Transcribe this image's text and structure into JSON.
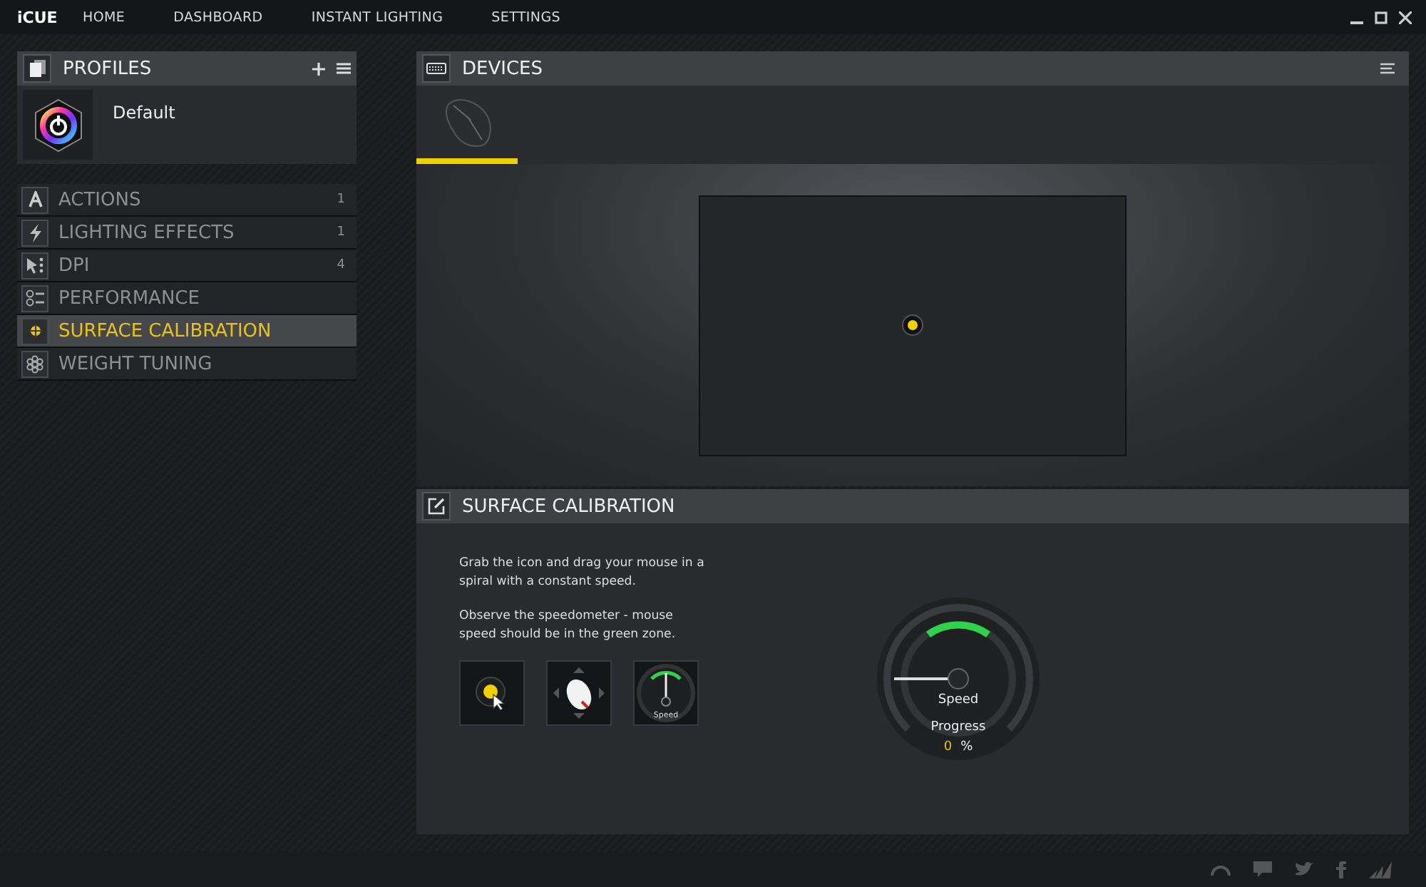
{
  "app": {
    "logo": "iCUE"
  },
  "nav": [
    {
      "label": "HOME"
    },
    {
      "label": "DASHBOARD"
    },
    {
      "label": "INSTANT LIGHTING"
    },
    {
      "label": "SETTINGS"
    }
  ],
  "profiles": {
    "title": "PROFILES",
    "items": [
      {
        "name": "Default"
      }
    ]
  },
  "menu": [
    {
      "label": "ACTIONS",
      "count": "1",
      "selected": false
    },
    {
      "label": "LIGHTING EFFECTS",
      "count": "1",
      "selected": false
    },
    {
      "label": "DPI",
      "count": "4",
      "selected": false
    },
    {
      "label": "PERFORMANCE",
      "selected": false
    },
    {
      "label": "SURFACE CALIBRATION",
      "selected": true
    },
    {
      "label": "WEIGHT TUNING",
      "selected": false
    }
  ],
  "devices": {
    "title": "DEVICES",
    "tabs": [
      {
        "selected": true
      }
    ]
  },
  "calibration": {
    "title": "SURFACE CALIBRATION",
    "instructions": [
      "Grab the icon and drag your mouse in a spiral with a constant speed.",
      "Observe the speedometer - mouse speed should be in the green zone."
    ],
    "step_speed_label": "Speed",
    "gauge": {
      "speed_label": "Speed",
      "progress_label": "Progress",
      "progress_value": "0",
      "unit": "%"
    }
  }
}
